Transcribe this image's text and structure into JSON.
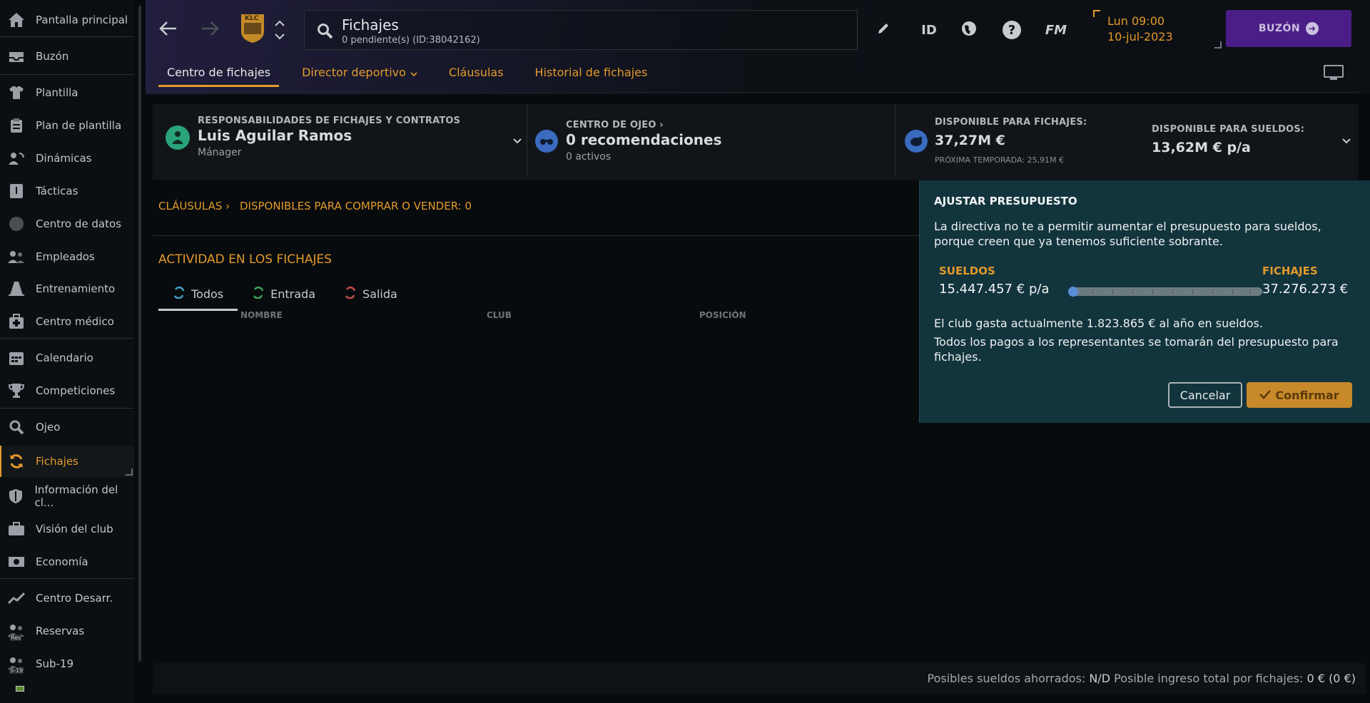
{
  "sidebar": {
    "items": [
      {
        "label": "Pantalla principal",
        "icon": "home-icon"
      },
      {
        "label": "Buzón",
        "icon": "inbox-icon"
      },
      {
        "label": "Plantilla",
        "icon": "shirt-icon"
      },
      {
        "label": "Plan de plantilla",
        "icon": "clipboard-icon"
      },
      {
        "label": "Dinámicas",
        "icon": "dynamics-icon"
      },
      {
        "label": "Tácticas",
        "icon": "tactics-icon"
      },
      {
        "label": "Centro de datos",
        "icon": "data-icon"
      },
      {
        "label": "Empleados",
        "icon": "staff-icon"
      },
      {
        "label": "Entrenamiento",
        "icon": "cone-icon"
      },
      {
        "label": "Centro médico",
        "icon": "medical-icon"
      },
      {
        "label": "Calendario",
        "icon": "calendar-icon"
      },
      {
        "label": "Competiciones",
        "icon": "trophy-icon"
      },
      {
        "label": "Ojeo",
        "icon": "magnifier-icon"
      },
      {
        "label": "Fichajes",
        "icon": "transfer-icon"
      },
      {
        "label": "Información del cl...",
        "icon": "shield-icon"
      },
      {
        "label": "Visión del club",
        "icon": "briefcase-icon"
      },
      {
        "label": "Economía",
        "icon": "money-icon"
      },
      {
        "label": "Centro Desarr.",
        "icon": "chart-icon"
      },
      {
        "label": "Reservas",
        "icon": "reserves-icon"
      },
      {
        "label": "Sub-19",
        "icon": "u19-icon"
      }
    ],
    "badge_reserves": "Res",
    "badge_u19": "S-19"
  },
  "header": {
    "crest_text": "KLC",
    "search_title": "Fichajes",
    "search_sub": "0 pendiente(s) (ID:38042162)",
    "icon_id": "ID",
    "icon_fm": "FM",
    "icon_help": "?",
    "date_line1": "Lun 09:00",
    "date_line2": "10-jul-2023",
    "buzon_label": "BUZÓN"
  },
  "tabs": {
    "t1": "Centro de fichajes",
    "t2": "Director deportivo",
    "t3": "Cláusulas",
    "t4": "Historial de fichajes"
  },
  "info": {
    "resp_label": "RESPONSABILIDADES DE FICHAJES Y CONTRATOS",
    "resp_name": "Luis Aguilar Ramos",
    "resp_role": "Mánager",
    "scout_label": "CENTRO DE OJEO",
    "scout_value": "0 recomendaciones",
    "scout_sub": "0 activos",
    "transfer_label": "DISPONIBLE PARA FICHAJES:",
    "transfer_value": "37,27M €",
    "transfer_next": "PRÓXIMA TEMPORADA: 25,91M €",
    "wage_label": "DISPONIBLE PARA SUELDOS:",
    "wage_value": "13,62M € p/a"
  },
  "clausulas": {
    "link": "CLÁUSULAS",
    "available": "DISPONIBLES PARA COMPRAR O VENDER: 0"
  },
  "activity": {
    "title": "ACTIVIDAD EN LOS FICHAJES",
    "tab_all": "Todos",
    "tab_in": "Entrada",
    "tab_out": "Salida",
    "col_name": "NOMBRE",
    "col_club": "CLUB",
    "col_pos": "POSICIÓN"
  },
  "footer": {
    "label1": "Posibles sueldos ahorrados:",
    "value1": "N/D",
    "label2": "Posible ingreso total por fichajes:",
    "value2": "0 € (0 €)"
  },
  "popup": {
    "title": "AJUSTAR PRESUPUESTO",
    "message": "La directiva no te a permitir aumentar el presupuesto para sueldos, porque creen que ya tenemos suficiente sobrante.",
    "left_label": "SUELDOS",
    "left_value": "15.447.457 € p/a",
    "right_label": "FICHAJES",
    "right_value": "37.276.273 €",
    "slider_fraction": 0.0,
    "info1": "El club gasta actualmente 1.823.865 € al año en sueldos.",
    "info2": "Todos los pagos a los representantes se tomarán del presupuesto para fichajes.",
    "cancel": "Cancelar",
    "confirm": "Confirmar"
  },
  "colors": {
    "accent": "#e39a2b",
    "buzon": "#4a1e86",
    "popup_bg": "#12343d"
  }
}
